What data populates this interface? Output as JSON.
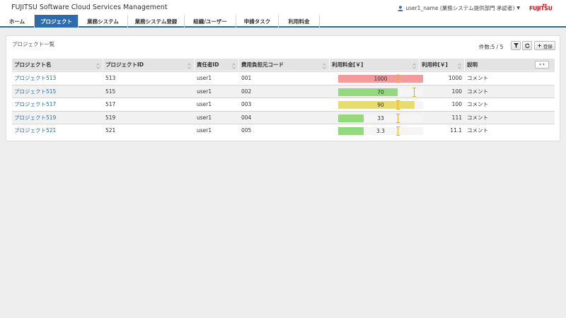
{
  "header": {
    "app_title": "FUJITSU Software Cloud Services Management",
    "user_label": "user1_name (業務システム提供部門 承認者)",
    "logo_text": "FUJITSU",
    "brand_color": "#e60012"
  },
  "nav": {
    "tabs": [
      {
        "label": "ホーム"
      },
      {
        "label": "プロジェクト",
        "active": true
      },
      {
        "label": "業務システム"
      },
      {
        "label": "業務システム登録"
      },
      {
        "label": "組織/ユーザー"
      },
      {
        "label": "申請タスク"
      },
      {
        "label": "利用料金"
      }
    ]
  },
  "panel": {
    "title": "プロジェクト一覧",
    "count_label": "件数:5 / 5",
    "register_label": "登録"
  },
  "table": {
    "columns": [
      "プロジェクト名",
      "プロジェクトID",
      "責任者ID",
      "費用負担元コード",
      "利用料金[￥]",
      "利用枠[￥]",
      "説明"
    ],
    "rows": [
      {
        "name": "プロジェクト513",
        "id": "513",
        "owner": "user1",
        "cost_code": "001",
        "usage": "1000",
        "limit": "1000",
        "desc": "コメント",
        "usage_ratio": 1.0,
        "bar_color": "#f19b9b"
      },
      {
        "name": "プロジェクト515",
        "id": "515",
        "owner": "user1",
        "cost_code": "002",
        "usage": "70",
        "limit": "100",
        "desc": "コメント",
        "usage_ratio": 0.7,
        "bar_color": "#95d97e"
      },
      {
        "name": "プロジェクト517",
        "id": "517",
        "owner": "user1",
        "cost_code": "003",
        "usage": "90",
        "limit": "100",
        "desc": "コメント",
        "usage_ratio": 0.9,
        "bar_color": "#e8dc6a"
      },
      {
        "name": "プロジェクト519",
        "id": "519",
        "owner": "user1",
        "cost_code": "004",
        "usage": "33",
        "limit": "111",
        "desc": "コメント",
        "usage_ratio": 0.3,
        "bar_color": "#95d97e"
      },
      {
        "name": "プロジェクト521",
        "id": "521",
        "owner": "user1",
        "cost_code": "005",
        "usage": "3.3",
        "limit": "11.1",
        "desc": "コメント",
        "usage_ratio": 0.3,
        "bar_color": "#95d97e"
      }
    ]
  },
  "colors": {
    "accent": "#2b6cb0",
    "limit_marker": "#e0b020"
  }
}
